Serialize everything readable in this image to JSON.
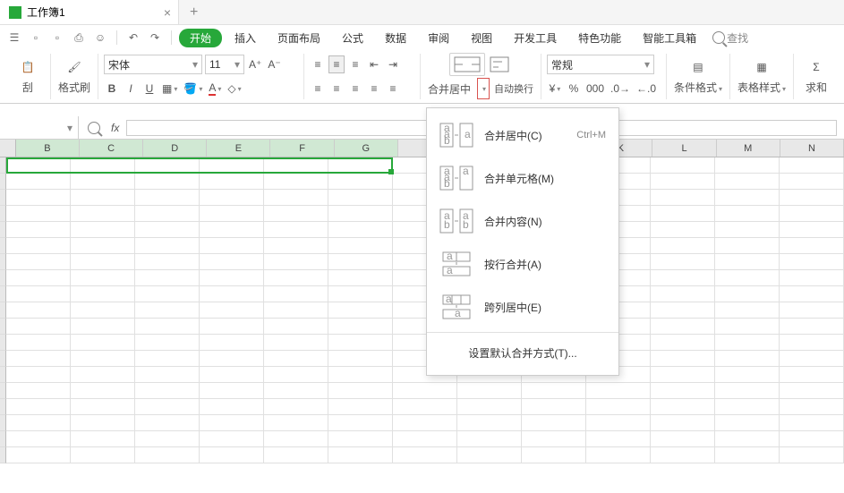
{
  "tab": {
    "title": "工作簿1"
  },
  "ribbonTabs": {
    "start": "开始",
    "insert": "插入",
    "layout": "页面布局",
    "formula": "公式",
    "data": "数据",
    "review": "审阅",
    "view": "视图",
    "dev": "开发工具",
    "special": "特色功能",
    "smart": "智能工具箱"
  },
  "search": {
    "label": "查找"
  },
  "font": {
    "name": "宋体",
    "size": "11"
  },
  "clipboard": {
    "paste": "刮",
    "copy": "格式刷"
  },
  "merge": {
    "label": "合并居中",
    "wrap": "自动换行"
  },
  "numfmt": {
    "general": "常规"
  },
  "cond": "条件格式",
  "tablestyle": "表格样式",
  "sum": "求和",
  "columns": [
    "B",
    "C",
    "D",
    "E",
    "F",
    "G",
    "",
    "",
    "K",
    "L",
    "M",
    "N"
  ],
  "mergeMenu": {
    "centerLabel": "合并居中(C)",
    "centerAccel": "Ctrl+M",
    "cellsLabel": "合并单元格(M)",
    "contentLabel": "合并内容(N)",
    "rowLabel": "按行合并(A)",
    "acrossLabel": "跨列居中(E)",
    "defaultLabel": "设置默认合并方式(T)..."
  }
}
